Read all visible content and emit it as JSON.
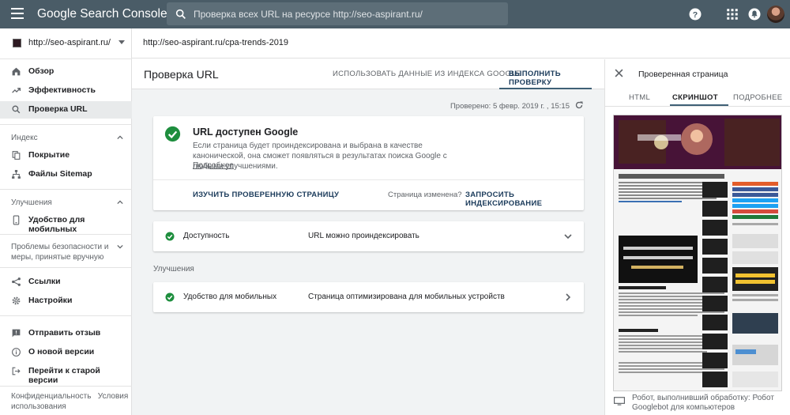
{
  "topbar": {
    "app_title": "Google Search Console",
    "search_placeholder": "Проверка всех URL на ресурсе http://seo-aspirant.ru/"
  },
  "sidebar": {
    "property": "http://seo-aspirant.ru/",
    "top_items": [
      {
        "label": "Обзор",
        "icon": "home-icon"
      },
      {
        "label": "Эффективность",
        "icon": "trending-up-icon"
      },
      {
        "label": "Проверка URL",
        "icon": "search-icon",
        "active": true
      }
    ],
    "section_index": "Индекс",
    "index_items": [
      {
        "label": "Покрытие",
        "icon": "copy-icon"
      },
      {
        "label": "Файлы Sitemap",
        "icon": "sitemap-icon"
      }
    ],
    "section_improvements": "Улучшения",
    "improvement_items": [
      {
        "label": "Удобство для мобильных",
        "icon": "phone-icon"
      }
    ],
    "section_security": "Проблемы безопасности и меры, принятые вручную",
    "other_items": [
      {
        "label": "Ссылки",
        "icon": "links-icon"
      },
      {
        "label": "Настройки",
        "icon": "gear-icon"
      }
    ],
    "bottom_items": [
      {
        "label": "Отправить отзыв",
        "icon": "feedback-icon"
      },
      {
        "label": "О новой версии",
        "icon": "info-icon"
      },
      {
        "label": "Перейти к старой версии",
        "icon": "exit-icon"
      }
    ],
    "footer_privacy": "Конфиденциальность",
    "footer_terms": "Условия использования"
  },
  "url_bar": {
    "url": "http://seo-aspirant.ru/cpa-trends-2019"
  },
  "main": {
    "title": "Проверка URL",
    "tab_index": "ИСПОЛЬЗОВАТЬ ДАННЫЕ ИЗ ИНДЕКСА GOOGLE",
    "tab_live": "ВЫПОЛНИТЬ ПРОВЕРКУ",
    "checked_at": "Проверено: 5 февр. 2019 г. , 15:15",
    "status_title": "URL доступен Google",
    "status_desc": "Если страница будет проиндексирована и выбрана в качестве канонической, она сможет появляться в результатах поиска Google с любыми улучшениями.",
    "more_link": "Подробнее",
    "view_page_btn": "ИЗУЧИТЬ ПРОВЕРЕННУЮ СТРАНИЦУ",
    "page_changed": "Страница изменена?",
    "request_index_btn": "ЗАПРОСИТЬ ИНДЕКСИРОВАНИЕ",
    "availability_label": "Доступность",
    "availability_value": "URL можно проиндексировать",
    "improvements_header": "Улучшения",
    "mobile_label": "Удобство для мобильных",
    "mobile_value": "Страница оптимизирована для мобильных устройств"
  },
  "panel": {
    "title": "Проверенная страница",
    "tabs": [
      "HTML",
      "СКРИНШОТ",
      "ПОДРОБНЕЕ"
    ],
    "selected_tab": "СКРИНШОТ",
    "footer": "Робот, выполнивший обработку: Робот Googlebot для компьютеров"
  },
  "colors": {
    "topbar": "#4a5c67",
    "success": "#1e8e3e",
    "accent_text": "#1a3a5a",
    "main_bg": "#f1f3f4"
  }
}
